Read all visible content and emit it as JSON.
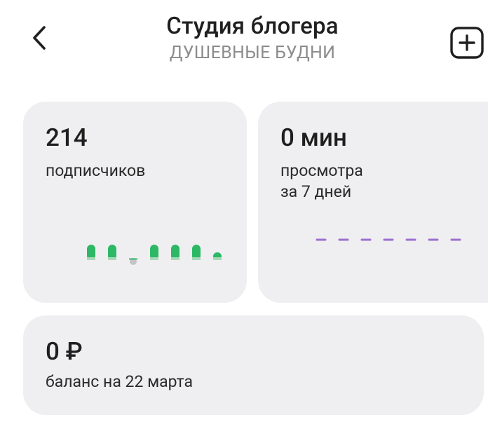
{
  "header": {
    "title": "Студия блогера",
    "subtitle": "ДУШЕВНЫЕ БУДНИ",
    "back_icon": "chevron-left-icon",
    "add_icon": "plus-square-icon"
  },
  "subscribers_card": {
    "value": "214",
    "label": "подписчиков",
    "bar_colors": {
      "positive": "#2db866",
      "neutral": "#c4c4c8"
    },
    "bars": [
      {
        "value": 1,
        "state": "positive"
      },
      {
        "value": 1,
        "state": "positive"
      },
      {
        "value": 0,
        "state": "neutral"
      },
      {
        "value": 1,
        "state": "positive"
      },
      {
        "value": 1,
        "state": "positive"
      },
      {
        "value": 1,
        "state": "positive"
      },
      {
        "value": 0.5,
        "state": "positive"
      }
    ]
  },
  "views_card": {
    "value": "0 мин",
    "label_line1": "просмотра",
    "label_line2": "за 7 дней",
    "dash_color": "#9c6fcf",
    "points": [
      0,
      0,
      0,
      0,
      0,
      0,
      0
    ]
  },
  "balance_card": {
    "value": "0 ₽",
    "label": "баланс на 22 марта"
  }
}
